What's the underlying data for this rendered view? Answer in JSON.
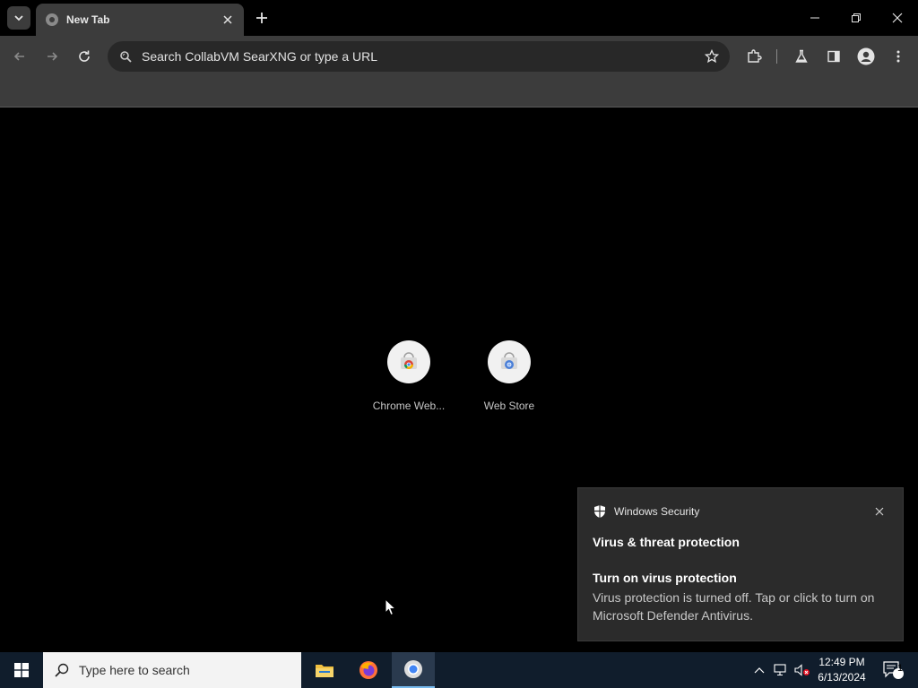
{
  "browser": {
    "tab": {
      "title": "New Tab"
    },
    "omnibox": {
      "placeholder": "Search CollabVM SearXNG or type a URL"
    }
  },
  "shortcuts": [
    {
      "label": "Chrome Web..."
    },
    {
      "label": "Web Store"
    }
  ],
  "toast": {
    "app_name": "Windows Security",
    "heading": "Virus & threat protection",
    "title": "Turn on virus protection",
    "body": "Virus protection is turned off. Tap or click to turn on Microsoft Defender Antivirus."
  },
  "taskbar": {
    "search_placeholder": "Type here to search",
    "time": "12:49 PM",
    "date": "6/13/2024",
    "notification_count": "1"
  },
  "colors": {
    "toolbar": "#3c3c3c",
    "omnibox": "#282828",
    "taskbar": "#101d2c",
    "toast": "#2b2b2b"
  }
}
